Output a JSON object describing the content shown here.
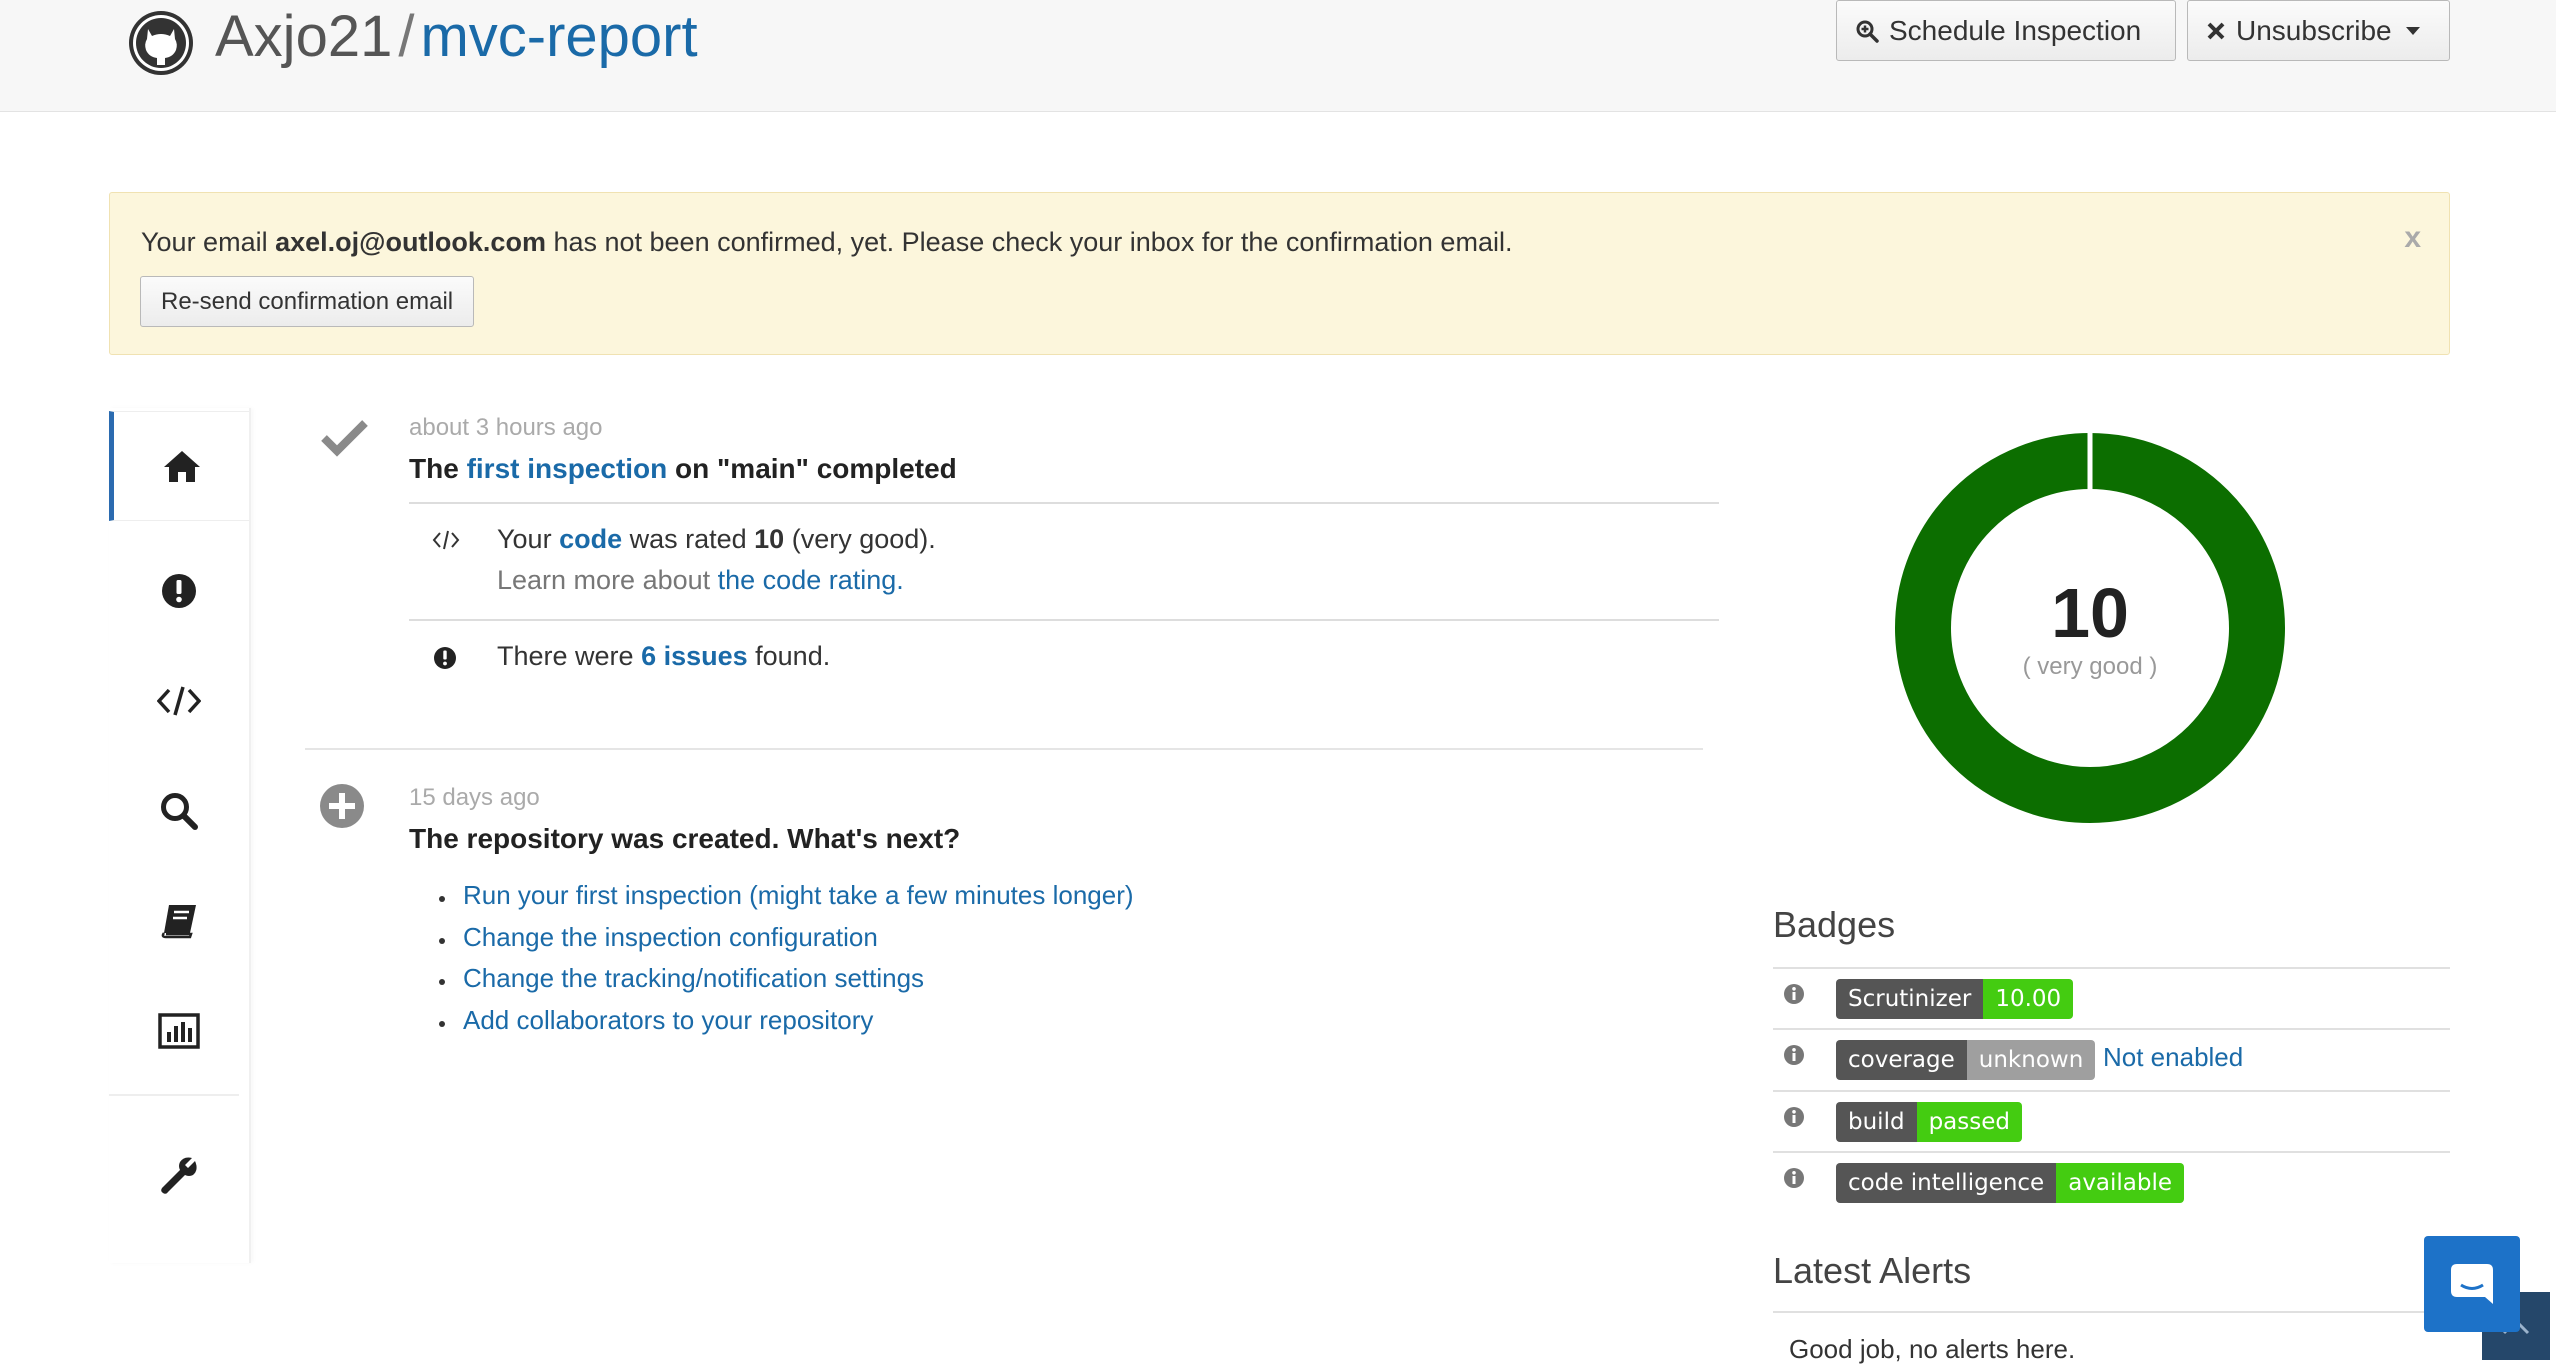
{
  "header": {
    "owner": "Axjo21",
    "separator": "/",
    "repo": "mvc-report",
    "schedule_label": "Schedule Inspection",
    "unsubscribe_label": "Unsubscribe"
  },
  "alert": {
    "prefix": "Your email ",
    "email": "axel.oj@outlook.com",
    "suffix": " has not been confirmed, yet. Please check your inbox for the confirmation email.",
    "close": "x",
    "resend_label": "Re-send confirmation email"
  },
  "sidebar": {
    "items": [
      {
        "icon": "home-icon",
        "active": true
      },
      {
        "icon": "issues-icon"
      },
      {
        "icon": "code-icon"
      },
      {
        "icon": "search-icon"
      },
      {
        "icon": "book-icon"
      },
      {
        "icon": "stats-icon"
      },
      {
        "icon": "wrench-icon"
      }
    ]
  },
  "timeline": {
    "inspection": {
      "time": "about 3 hours ago",
      "title_pre": "The ",
      "title_link": "first inspection",
      "title_post": " on \"main\" completed",
      "rating_pre": "Your ",
      "rating_link": "code",
      "rating_mid": " was rated ",
      "rating_value": "10",
      "rating_post": " (very good).",
      "learn_pre": "Learn more about ",
      "learn_link": "the code rating.",
      "issues_pre": "There were ",
      "issues_link": "6 issues",
      "issues_post": " found."
    },
    "created": {
      "time": "15 days ago",
      "title": "The repository was created. What's next?",
      "steps": [
        "Run your first inspection (might take a few minutes longer)",
        "Change the inspection configuration",
        "Change the tracking/notification settings",
        "Add collaborators to your repository"
      ]
    }
  },
  "score": {
    "value": "10",
    "label": "( very good )",
    "color": "#0c6e00"
  },
  "badges": {
    "title": "Badges",
    "items": [
      {
        "left": "Scrutinizer",
        "right": "10.00",
        "color": "#44cc11"
      },
      {
        "left": "coverage",
        "right": "unknown",
        "color": "#9f9f9f",
        "extra": "Not enabled"
      },
      {
        "left": "build",
        "right": "passed",
        "color": "#44cc11"
      },
      {
        "left": "code intelligence",
        "right": "available",
        "color": "#44cc11"
      }
    ]
  },
  "alerts": {
    "title": "Latest Alerts",
    "message": "Good job, no alerts here."
  }
}
